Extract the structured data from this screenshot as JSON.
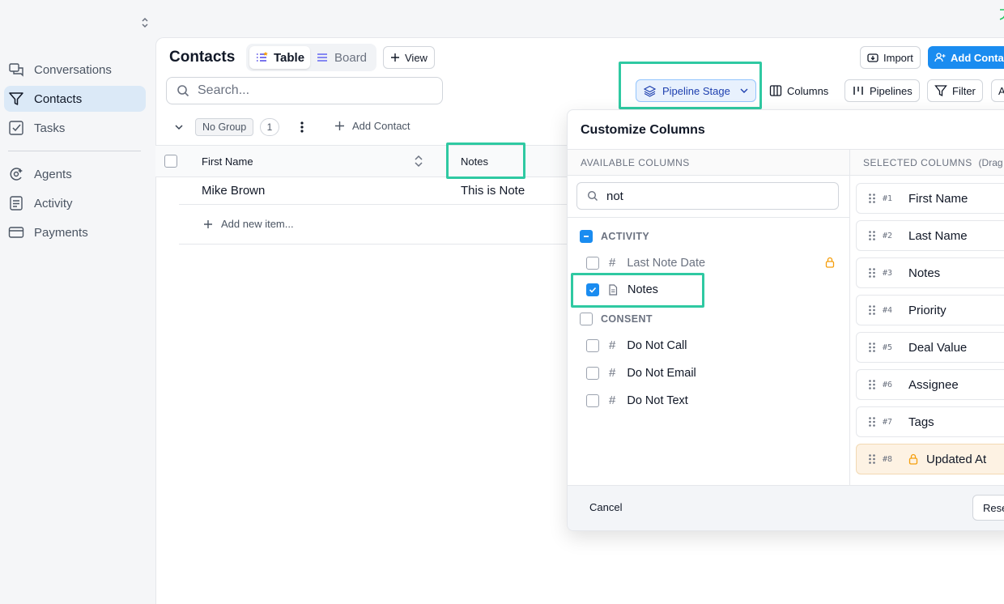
{
  "sidebar": {
    "items": [
      {
        "label": "Conversations",
        "icon": "chat-icon"
      },
      {
        "label": "Contacts",
        "icon": "filter-icon",
        "active": true
      },
      {
        "label": "Tasks",
        "icon": "task-check-icon"
      },
      {
        "label": "Agents",
        "icon": "agent-icon"
      },
      {
        "label": "Activity",
        "icon": "activity-icon"
      },
      {
        "label": "Payments",
        "icon": "card-icon"
      }
    ]
  },
  "header": {
    "title": "Contacts",
    "view_tabs": [
      {
        "label": "Table",
        "active": true
      },
      {
        "label": "Board",
        "active": false
      }
    ],
    "view_button": "View",
    "import_button": "Import",
    "add_contact_button": "Add Contac"
  },
  "toolbar": {
    "search_placeholder": "Search...",
    "pipeline_stage": "Pipeline Stage",
    "columns": "Columns",
    "pipelines": "Pipelines",
    "filter": "Filter",
    "more": "A"
  },
  "group": {
    "label": "No Group",
    "count": "1",
    "add_contact": "Add Contact"
  },
  "table": {
    "headers": [
      "First Name",
      "Notes"
    ],
    "rows": [
      {
        "first_name": "Mike Brown",
        "notes": "This is Note"
      }
    ],
    "add_item": "Add new item..."
  },
  "modal": {
    "title": "Customize Columns",
    "available_header": "AVAILABLE COLUMNS",
    "selected_header": "SELECTED COLUMNS",
    "selected_hint": "(Drag t",
    "search_value": "not",
    "groups": [
      {
        "label": "ACTIVITY",
        "items": [
          {
            "label": "Last Note Date",
            "type": "number",
            "locked": true,
            "checked": false
          },
          {
            "label": "Notes",
            "type": "document",
            "checked": true
          }
        ]
      },
      {
        "label": "CONSENT",
        "items": [
          {
            "label": "Do Not Call",
            "type": "number",
            "checked": false
          },
          {
            "label": "Do Not Email",
            "type": "number",
            "checked": false
          },
          {
            "label": "Do Not Text",
            "type": "number",
            "checked": false
          }
        ]
      }
    ],
    "selected": [
      {
        "num": "#1",
        "label": "First Name"
      },
      {
        "num": "#2",
        "label": "Last Name"
      },
      {
        "num": "#3",
        "label": "Notes"
      },
      {
        "num": "#4",
        "label": "Priority"
      },
      {
        "num": "#5",
        "label": "Deal Value"
      },
      {
        "num": "#6",
        "label": "Assignee"
      },
      {
        "num": "#7",
        "label": "Tags"
      },
      {
        "num": "#8",
        "label": "Updated At",
        "locked": true
      }
    ],
    "cancel": "Cancel",
    "reset": "Rese"
  },
  "colors": {
    "accent": "#1a8cf0",
    "highlight": "#2fc9a2",
    "lock": "#f59e0b"
  }
}
